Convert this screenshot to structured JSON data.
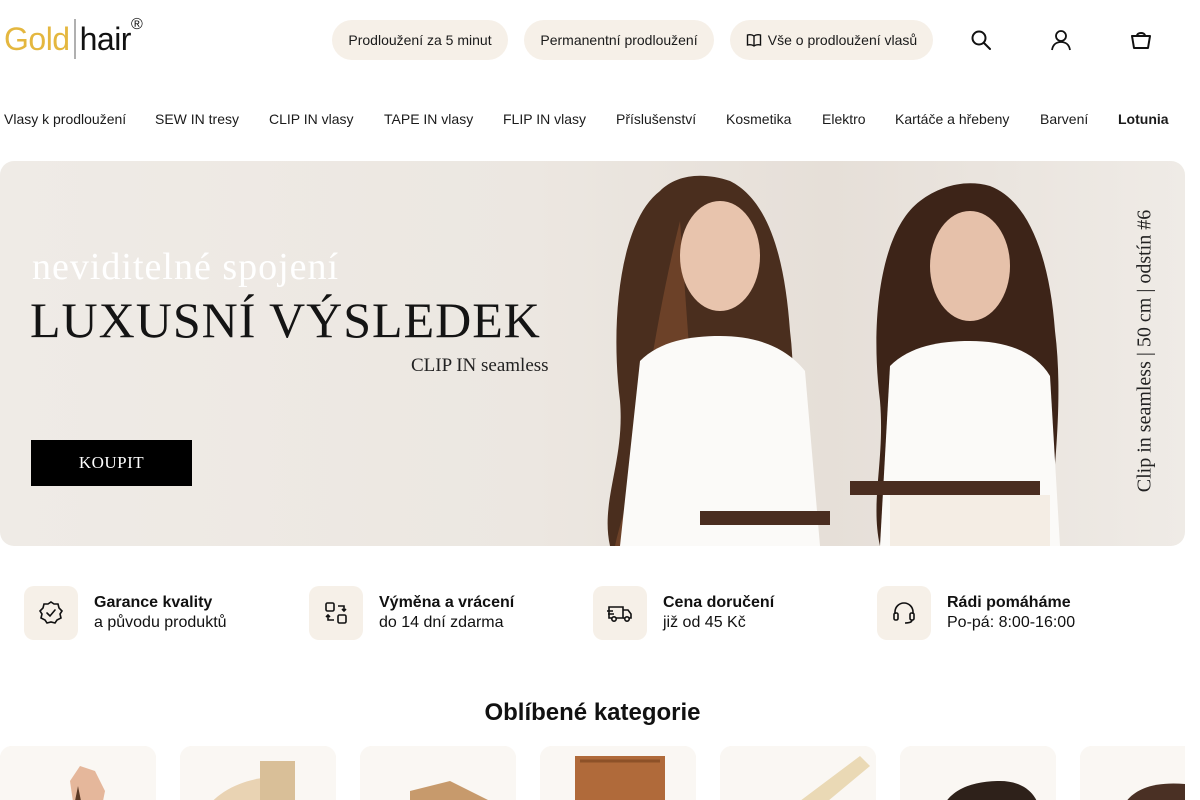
{
  "logo": {
    "part1": "Gold",
    "part2": "hair",
    "mark": "®"
  },
  "header": {
    "pills": [
      {
        "label": "Prodloužení za 5 minut"
      },
      {
        "label": "Permanentní prodloužení"
      },
      {
        "label": "Vše o prodloužení vlasů",
        "icon": "book-icon"
      }
    ],
    "icons": [
      "search-icon",
      "user-icon",
      "cart-icon"
    ]
  },
  "nav": {
    "items": [
      {
        "label": "Vlasy k prodloužení"
      },
      {
        "label": "SEW IN tresy"
      },
      {
        "label": "CLIP IN vlasy"
      },
      {
        "label": "TAPE IN vlasy"
      },
      {
        "label": "FLIP IN vlasy"
      },
      {
        "label": "Příslušenství"
      },
      {
        "label": "Kosmetika"
      },
      {
        "label": "Elektro"
      },
      {
        "label": "Kartáče a hřebeny"
      },
      {
        "label": "Barvení"
      },
      {
        "label": "Lotunia",
        "active": true
      }
    ]
  },
  "hero": {
    "subtitle": "neviditelné spojení",
    "title": "LUXUSNÍ VÝSLEDEK",
    "tag": "CLIP IN seamless",
    "button": "KOUPIT",
    "side_text": "Clip in seamless | 50 cm | odstín #6"
  },
  "features": [
    {
      "title": "Garance kvality",
      "text": "a původu produktů",
      "icon": "quality-badge-icon"
    },
    {
      "title": "Výměna a vrácení",
      "text": "do 14 dní zdarma",
      "icon": "exchange-icon"
    },
    {
      "title": "Cena doručení",
      "text": "již od 45 Kč",
      "icon": "delivery-truck-icon"
    },
    {
      "title": "Rádi pomáháme",
      "text": "Po-pá: 8:00-16:00",
      "icon": "headset-icon"
    }
  ],
  "categories": {
    "title": "Oblíbené kategorie"
  },
  "colors": {
    "accent": "#e4b73f",
    "pill_bg": "#f6f0e8",
    "hero_bg": "#ece7e1"
  }
}
